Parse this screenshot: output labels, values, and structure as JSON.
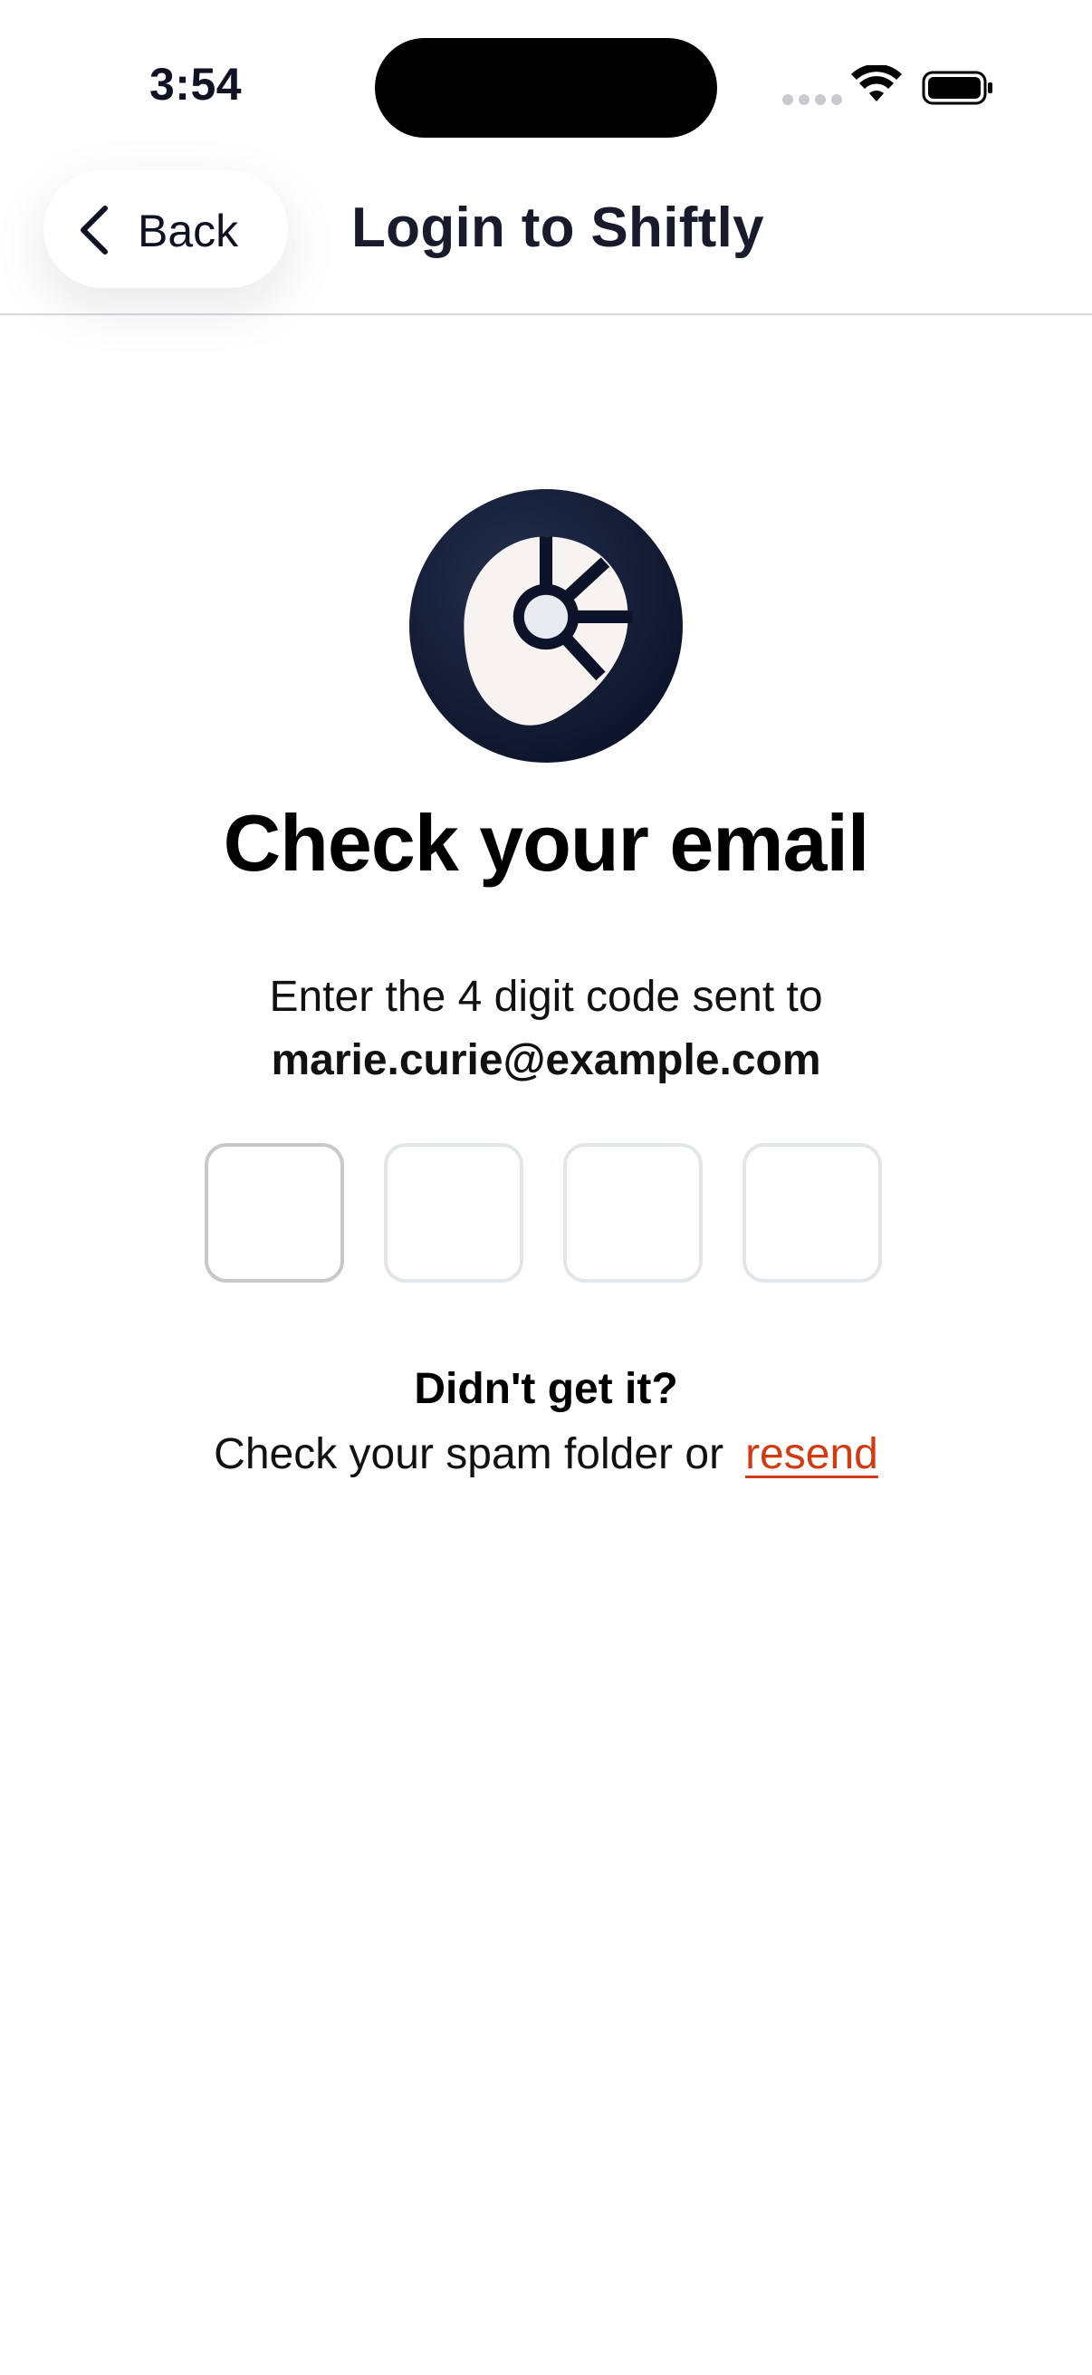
{
  "status_bar": {
    "time": "3:54"
  },
  "nav": {
    "back_label": "Back",
    "title": "Login to Shiftly"
  },
  "icons": {
    "back": "chevron-left-icon",
    "logo": "shiftly-logo-icon",
    "wifi": "wifi-icon",
    "battery": "battery-icon"
  },
  "main": {
    "headline": "Check your email",
    "instruction": "Enter the 4 digit code sent to",
    "email": "marie.curie@example.com",
    "code_boxes": [
      "",
      "",
      "",
      ""
    ],
    "help_title": "Didn't get it?",
    "help_text": "Check your spam folder or",
    "resend_label": "resend"
  },
  "colors": {
    "text_primary": "#0f1222",
    "logo_dark": "#141a30",
    "resend_link": "#d23a12",
    "box_border": "#e3e6e9",
    "box_border_active": "#c7c8ca"
  }
}
